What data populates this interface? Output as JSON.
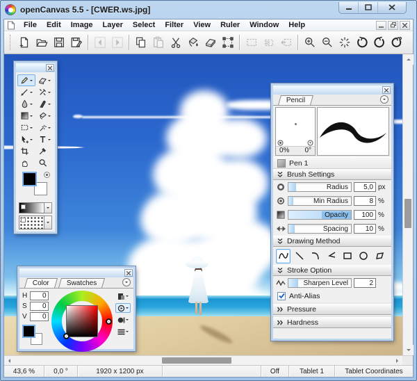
{
  "window": {
    "title": "openCanvas 5.5 - [CWER.ws.jpg]"
  },
  "menu": {
    "items": [
      "File",
      "Edit",
      "Image",
      "Layer",
      "Select",
      "Filter",
      "View",
      "Ruler",
      "Window",
      "Help"
    ]
  },
  "toolbar": {
    "buttons": [
      "new",
      "open",
      "save",
      "save-as",
      "back",
      "forward",
      "copy",
      "paste",
      "cut",
      "fill",
      "eraser",
      "transform",
      "select-rectangle",
      "deselect",
      "move-selection",
      "zoom-in",
      "zoom-out",
      "actual-size",
      "rotate-ccw",
      "rotate-cw",
      "reset-rotation"
    ],
    "disabled": [
      "back",
      "forward",
      "paste",
      "select-rectangle",
      "deselect",
      "move-selection"
    ]
  },
  "tool_palette": {
    "tools": [
      "pencil",
      "eraser",
      "pen",
      "marker",
      "waterdrop",
      "finger",
      "gradation",
      "bucket",
      "select",
      "magic-wand",
      "object-select",
      "text",
      "crop",
      "eyedropper",
      "hand",
      "zoom"
    ],
    "selected_tool": "pencil"
  },
  "color_panel": {
    "tabs": [
      "Color",
      "Swatches"
    ],
    "active_tab": "Color",
    "hsv_rows": [
      {
        "label": "H",
        "value": "0"
      },
      {
        "label": "S",
        "value": "0"
      },
      {
        "label": "V",
        "value": "0"
      }
    ],
    "modes": [
      "square",
      "wheel",
      "bar",
      "sliders"
    ],
    "selected_mode": "wheel"
  },
  "pencil_panel": {
    "tab": "Pencil",
    "tip": {
      "pressure": "0%",
      "angle": "0°"
    },
    "pen_name": "Pen 1",
    "brush_settings": {
      "title": "Brush Settings",
      "rows": [
        {
          "label": "Radius",
          "value": "5,0",
          "unit": "px"
        },
        {
          "label": "Min Radius",
          "value": "8",
          "unit": "%"
        },
        {
          "label": "Opacity",
          "value": "100",
          "unit": "%"
        },
        {
          "label": "Spacing",
          "value": "10",
          "unit": "%"
        }
      ]
    },
    "drawing_method": {
      "title": "Drawing Method",
      "methods": [
        "freehand",
        "line",
        "curve",
        "polyline",
        "rectangle",
        "ellipse",
        "polygon"
      ],
      "selected": "freehand"
    },
    "stroke_option": {
      "title": "Stroke Option",
      "sharpen_label": "Sharpen Level",
      "sharpen_value": "2",
      "antialias_label": "Anti-Alias",
      "antialias_checked": true
    },
    "pressure_title": "Pressure",
    "hardness_title": "Hardness"
  },
  "statusbar": {
    "zoom": "43,6 %",
    "rotation": "0,0 °",
    "canvas_size": "1920 x 1200 px",
    "message": "",
    "pen_pressure": "Off",
    "tablet": "Tablet 1",
    "tablet_mode": "Tablet Coordinates"
  },
  "colors": {
    "selection_border": "#74aee4",
    "selection_fill": "#d6e9fb",
    "slider_fill": "#a9d1f2",
    "frame_blue": "#aac8ea",
    "foreground": "#000000",
    "background": "#ffffff",
    "sky_top": "#2256bd",
    "sea": "#2aa5dc",
    "sand": "#dfcca0"
  }
}
